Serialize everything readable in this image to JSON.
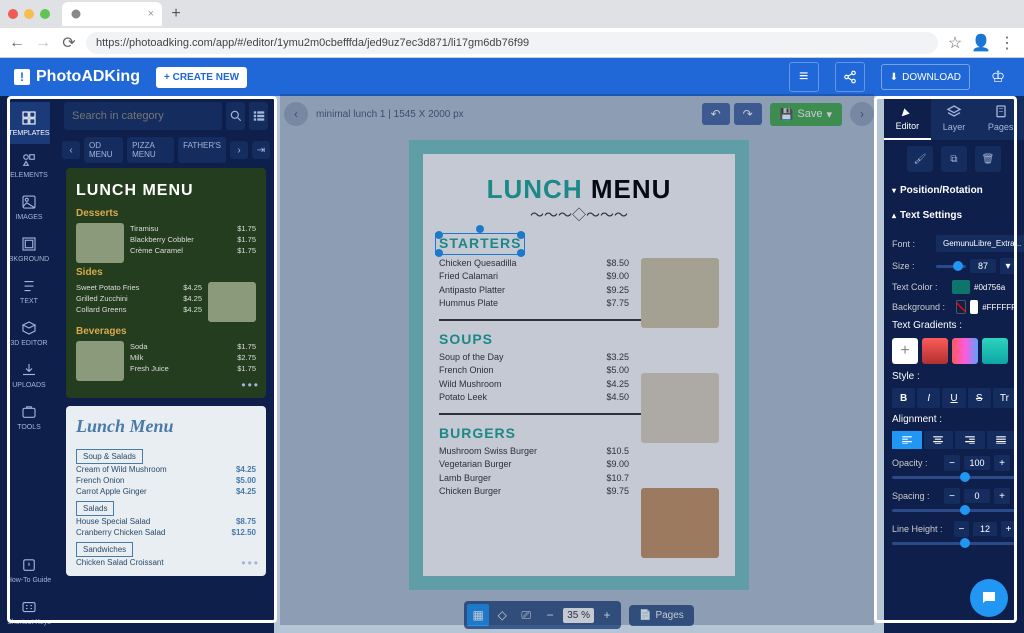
{
  "browser": {
    "url": "https://photoadking.com/app/#/editor/1ymu2m0cbefffda/jed9uz7ec3d871/li17gm6db76f99"
  },
  "app": {
    "brand": "PhotoADKing",
    "create": "+ CREATE NEW",
    "download": "DOWNLOAD"
  },
  "leftNav": [
    {
      "label": "TEMPLATES"
    },
    {
      "label": "ELEMENTS"
    },
    {
      "label": "IMAGES"
    },
    {
      "label": "BKGROUND"
    },
    {
      "label": "TEXT"
    },
    {
      "label": "3D EDITOR"
    },
    {
      "label": "UPLOADS"
    },
    {
      "label": "TOOLS"
    }
  ],
  "leftNavBottom": [
    {
      "label": "How-To Guide"
    },
    {
      "label": "Shortcut Keys"
    }
  ],
  "search": {
    "placeholder": "Search in category"
  },
  "chips": [
    "OD MENU",
    "PIZZA MENU",
    "FATHER'S"
  ],
  "tpl1": {
    "title": "LUNCH MENU",
    "sections": [
      {
        "name": "Desserts",
        "img": true,
        "imgSide": "left",
        "items": [
          [
            "Tiramisu",
            "$1.75"
          ],
          [
            "Blackberry Cobbler",
            "$1.75"
          ],
          [
            "Crème Caramel",
            "$1.75"
          ]
        ]
      },
      {
        "name": "Sides",
        "img": true,
        "imgSide": "right",
        "items": [
          [
            "Sweet Potato Fries",
            "$4.25"
          ],
          [
            "Grilled Zucchini",
            "$4.25"
          ],
          [
            "Collard Greens",
            "$4.25"
          ]
        ]
      },
      {
        "name": "Beverages",
        "img": true,
        "imgSide": "left",
        "items": [
          [
            "Soda",
            "$1.75"
          ],
          [
            "Milk",
            "$2.75"
          ],
          [
            "Fresh Juice",
            "$1.75"
          ]
        ]
      }
    ]
  },
  "tpl2": {
    "title": "Lunch Menu",
    "sections": [
      {
        "name": "Soup & Salads",
        "items": [
          [
            "Cream of Wild Mushroom",
            "$4.25"
          ],
          [
            "French Onion",
            "$5.00"
          ],
          [
            "Carrot Apple Ginger",
            "$4.25"
          ]
        ]
      },
      {
        "name": "Salads",
        "items": [
          [
            "House Special Salad",
            "$8.75"
          ],
          [
            "Cranberry Chicken Salad",
            "$12.50"
          ]
        ]
      },
      {
        "name": "Sandwiches",
        "items": [
          [
            "Chicken Salad Croissant",
            ""
          ]
        ]
      }
    ]
  },
  "doc": {
    "name": "minimal lunch 1 | 1545 X 2000 px",
    "save": "Save",
    "zoom": "35 %",
    "pages": "Pages"
  },
  "menu": {
    "title1": "LUNCH",
    "title2": " MENU",
    "sections": [
      {
        "h": "STARTERS",
        "selected": true,
        "img": 1,
        "items": [
          [
            "Chicken Quesadilla",
            "$8.50"
          ],
          [
            "Fried Calamari",
            "$9.00"
          ],
          [
            "Antipasto Platter",
            "$9.25"
          ],
          [
            "Hummus Plate",
            "$7.75"
          ]
        ]
      },
      {
        "h": "SOUPS",
        "img": 2,
        "items": [
          [
            "Soup of the Day",
            "$3.25"
          ],
          [
            "French Onion",
            "$5.00"
          ],
          [
            "Wild Mushroom",
            "$4.25"
          ],
          [
            "Potato Leek",
            "$4.50"
          ]
        ]
      },
      {
        "h": "BURGERS",
        "img": 3,
        "items": [
          [
            "Mushroom Swiss Burger",
            "$10.5"
          ],
          [
            "Vegetarian Burger",
            "$9.00"
          ],
          [
            "Lamb Burger",
            "$10.7"
          ],
          [
            "Chicken Burger",
            "$9.75"
          ]
        ]
      }
    ]
  },
  "right": {
    "tabs": [
      "Editor",
      "Layer",
      "Pages"
    ],
    "posrot": "Position/Rotation",
    "textset": "Text Settings",
    "font": {
      "label": "Font :",
      "value": "GemunuLibre_Extra..."
    },
    "size": {
      "label": "Size :",
      "value": "87"
    },
    "textcolor": {
      "label": "Text Color :",
      "sw": "#0d756a",
      "hex": "#0d756a"
    },
    "bg": {
      "label": "Background :",
      "hex": "#FFFFFF"
    },
    "grad": "Text Gradients :",
    "style": "Style :",
    "styleBtns": [
      "B",
      "I",
      "U",
      "S",
      "Tr"
    ],
    "align": "Alignment :",
    "opacity": {
      "label": "Opacity :",
      "value": "100"
    },
    "spacing": {
      "label": "Spacing :",
      "value": "0"
    },
    "lineheight": {
      "label": "Line Height :",
      "value": "12"
    }
  }
}
